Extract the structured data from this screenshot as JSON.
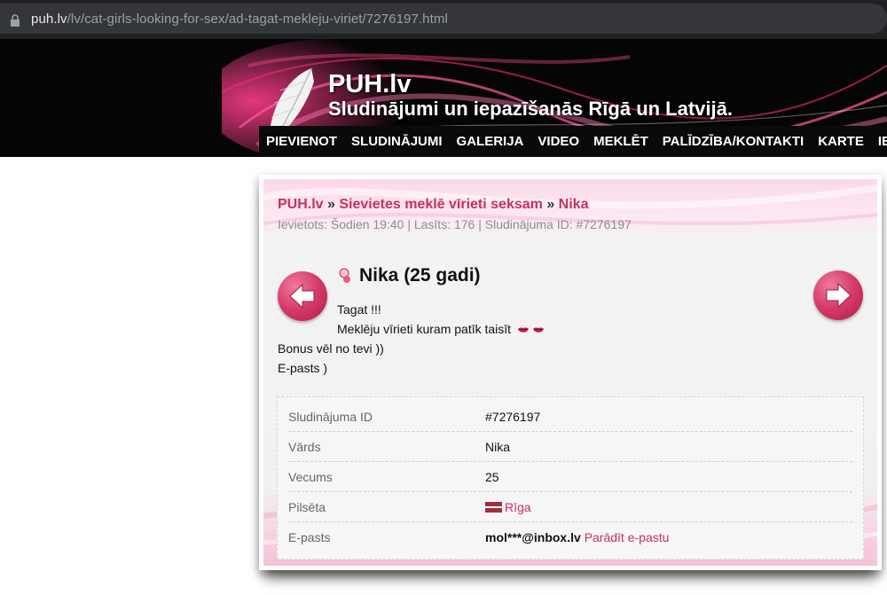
{
  "browser": {
    "url_domain": "puh.lv",
    "url_path": "/lv/cat-girls-looking-for-sex/ad-tagat-mekleju-viriet/7276197.html"
  },
  "site": {
    "title": "PUH.lv",
    "subtitle": "Sludinājumi un iepazīšanās Rīgā un Latvijā.",
    "nav": [
      "PIEVIENOT",
      "SLUDINĀJUMI",
      "GALERIJA",
      "VIDEO",
      "MEKLĒT",
      "PALĪDZĪBA/KONTAKTI",
      "KARTE",
      "IEN"
    ]
  },
  "breadcrumb": {
    "home": "PUH.lv",
    "sep1": " » ",
    "category": "Sievietes meklē vīrieti seksam",
    "sep2": " » ",
    "current": "Nika"
  },
  "meta": "Ievietots: Šodien 19:40 | Lasīts: 176 | Sludinājuma ID: #7276197",
  "ad": {
    "title": "Nika (25 gadi)",
    "lines": [
      "Tagat !!!",
      "Meklēju vīrieti kuram patīk taisīt",
      "Bonus vēl no tevi ))",
      "E-pasts )"
    ],
    "emoji_icons": [
      "lips-icon",
      "lips-icon"
    ]
  },
  "details": [
    {
      "label": "Sludinājuma ID",
      "value": "#7276197"
    },
    {
      "label": "Vārds",
      "value": "Nika"
    },
    {
      "label": "Vecums",
      "value": "25"
    },
    {
      "label": "Pilsēta",
      "value": "Rīga"
    },
    {
      "label": "E-pasts",
      "value": "mol***@inbox.lv",
      "action": "Parādīt e-pastu"
    }
  ],
  "colors": {
    "accent": "#c7305f",
    "arrow": "#d53a68",
    "header_bg": "#050505"
  }
}
